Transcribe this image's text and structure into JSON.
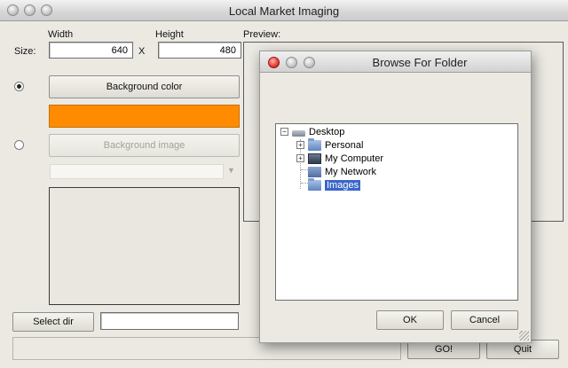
{
  "window": {
    "title": "Local Market Imaging"
  },
  "size": {
    "label": "Size:",
    "width_label": "Width",
    "height_label": "Height",
    "width": "640",
    "height": "480",
    "separator": "X"
  },
  "preview": {
    "label": "Preview:"
  },
  "background": {
    "color_button": "Background color",
    "image_button": "Background image",
    "swatch_color": "#ff8c00",
    "color_selected": true
  },
  "bottom": {
    "select_dir": "Select dir",
    "dir_value": "",
    "go": "GO!",
    "quit": "Quit"
  },
  "dialog": {
    "title": "Browse For Folder",
    "ok": "OK",
    "cancel": "Cancel",
    "tree": [
      {
        "label": "Desktop",
        "icon": "desktop-icon",
        "expanded": true
      },
      {
        "label": "Personal",
        "icon": "folder-icon",
        "expandable": true
      },
      {
        "label": "My Computer",
        "icon": "computer-icon",
        "expandable": true
      },
      {
        "label": "My Network",
        "icon": "network-icon",
        "expandable": false
      },
      {
        "label": "Images",
        "icon": "folder-icon",
        "expandable": false,
        "selected": true
      }
    ]
  }
}
